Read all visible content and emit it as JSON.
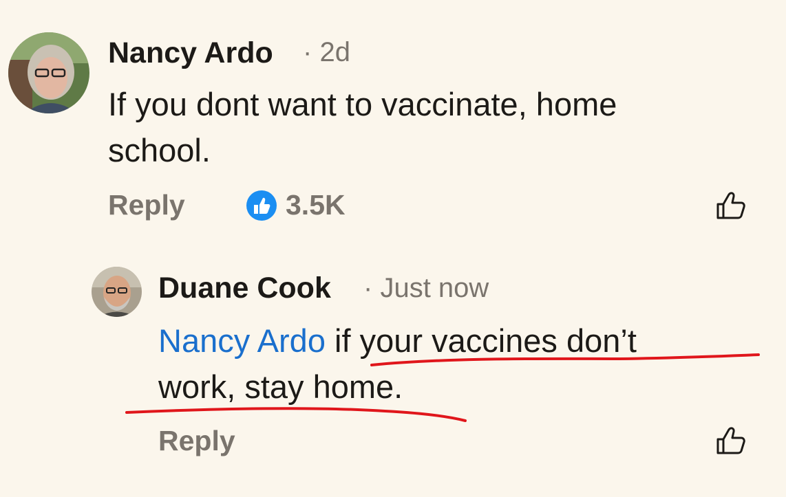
{
  "comments": [
    {
      "author": "Nancy Ardo",
      "separator": "·",
      "time": "2d",
      "text": "If you dont want to vaccinate, home school.",
      "text_line1": "If you dont want to vaccinate, home",
      "text_line2": "school.",
      "reply_label": "Reply",
      "reaction_count": "3.5K",
      "reaction_icon": "like-badge-icon",
      "like_icon": "thumbs-up-outline-icon"
    },
    {
      "author": "Duane Cook",
      "separator": "·",
      "time": "Just now",
      "mention": "Nancy Ardo",
      "text_line1_rest": " if your vaccines don’t",
      "text_line2": "work, stay home.",
      "reply_label": "Reply",
      "like_icon": "thumbs-up-outline-icon"
    }
  ],
  "colors": {
    "background": "#fbf6ec",
    "mention": "#1a6fcd",
    "like_badge": "#1b8ef2",
    "annotation": "#e0161b",
    "meta_text": "#7a746d"
  }
}
